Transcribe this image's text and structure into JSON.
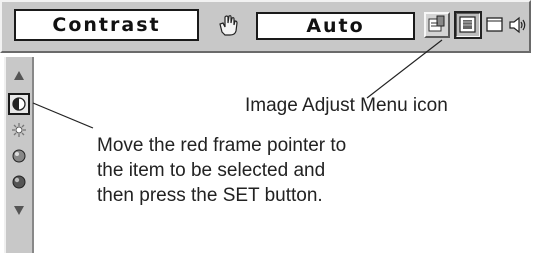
{
  "menu": {
    "item_label": "Contrast",
    "value_label": "Auto",
    "icons": [
      "hand-pointer-icon",
      "settings-icon",
      "image-adjust-icon",
      "screen-icon",
      "sound-icon"
    ]
  },
  "sidebar": {
    "items": [
      "arrow-up-icon",
      "contrast-icon",
      "brightness-icon",
      "color-icon",
      "tint-icon",
      "arrow-down-icon"
    ]
  },
  "callouts": {
    "menu_icon": "Image Adjust Menu icon",
    "pointer_line1": "Move the red frame pointer to",
    "pointer_line2": "the item to be selected and",
    "pointer_line3": "then press the SET button."
  }
}
